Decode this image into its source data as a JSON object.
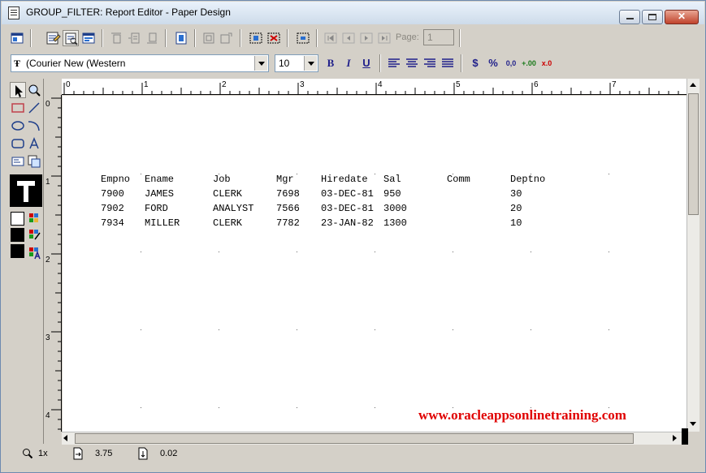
{
  "window": {
    "title": "GROUP_FILTER: Report Editor - Paper Design",
    "close_glyph": "✕",
    "accent": "#cddbea"
  },
  "toolbar": {
    "page_label": "Page:",
    "page_value": "1"
  },
  "format_bar": {
    "font": "(Courier New (Western",
    "font_size": "10",
    "bold": "B",
    "italic": "I",
    "underline": "U",
    "currency": "$",
    "percent": "%",
    "comma": "0,0",
    "add_decimal": "+.00",
    "remove_decimal": "x.0"
  },
  "ruler": {
    "horizontal": [
      "0",
      "1",
      "2",
      "3",
      "4",
      "5",
      "6",
      "7"
    ],
    "vertical": [
      "0",
      "1",
      "2",
      "3",
      "4"
    ]
  },
  "report": {
    "headers": [
      "Empno",
      "Ename",
      "Job",
      "Mgr",
      "Hiredate",
      "Sal",
      "Comm",
      "Deptno"
    ],
    "rows": [
      [
        "7900",
        "JAMES",
        "CLERK",
        "7698",
        "03-DEC-81",
        "950",
        "",
        "30"
      ],
      [
        "7902",
        "FORD",
        "ANALYST",
        "7566",
        "03-DEC-81",
        "3000",
        "",
        "20"
      ],
      [
        "7934",
        "MILLER",
        "CLERK",
        "7782",
        "23-JAN-82",
        "1300",
        "",
        "10"
      ]
    ]
  },
  "watermark": "www.oracleappsonlinetraining.com",
  "status": {
    "zoom": "1x",
    "x_pos": "3.75",
    "y_pos": "0.02"
  },
  "colors": {
    "palette_fill": "#ffffff",
    "palette_line": "#000000",
    "palette_text": "#000000",
    "watermark": "#e00000"
  }
}
